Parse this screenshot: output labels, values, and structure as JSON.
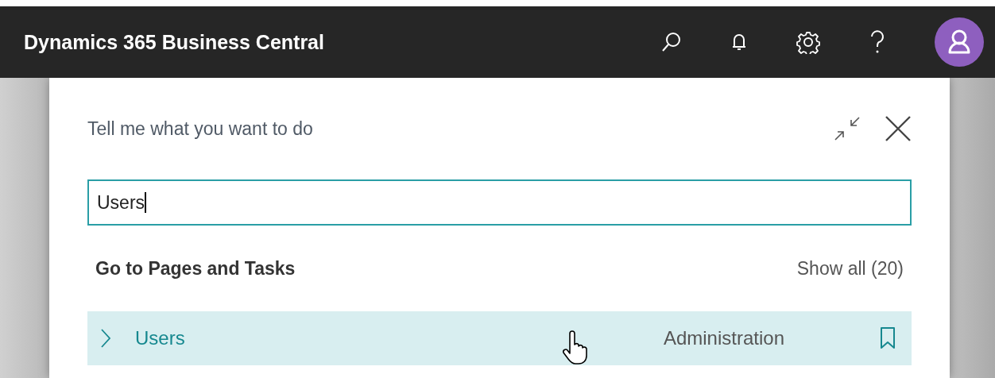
{
  "header": {
    "title": "Dynamics 365 Business Central"
  },
  "panel": {
    "title": "Tell me what you want to do",
    "search": {
      "value": "Users"
    },
    "section": {
      "title": "Go to Pages and Tasks",
      "show_all": "Show all (20)",
      "results": [
        {
          "title": "Users",
          "category": "Administration",
          "selected": true
        }
      ]
    }
  }
}
